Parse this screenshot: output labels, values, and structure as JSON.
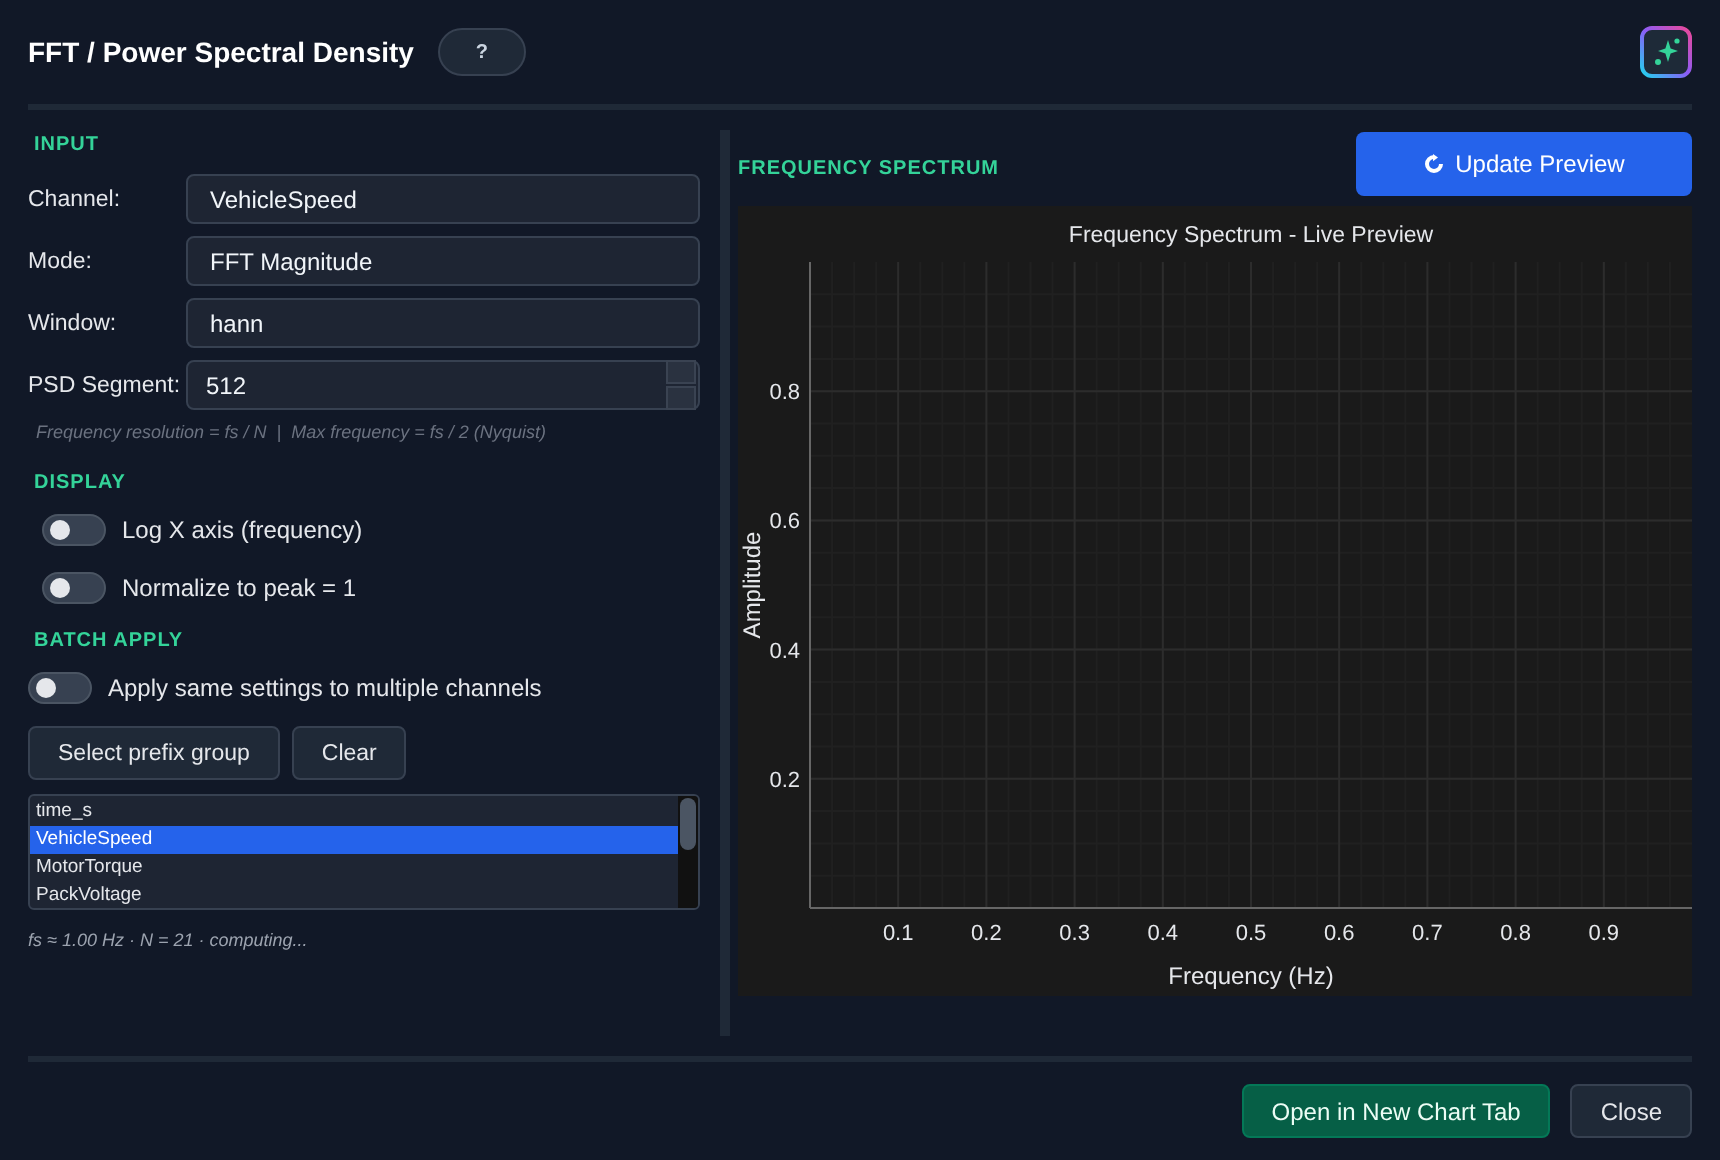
{
  "window": {
    "title": "FFT / Power Spectral Density",
    "help_button": "?"
  },
  "input": {
    "heading": "INPUT",
    "fields": [
      {
        "label": "Channel:",
        "value": "VehicleSpeed",
        "kind": "text"
      },
      {
        "label": "Mode:",
        "value": "FFT Magnitude",
        "kind": "text"
      },
      {
        "label": "Window:",
        "value": "hann",
        "kind": "text"
      },
      {
        "label": "PSD Segment:",
        "value": "512",
        "kind": "spin"
      }
    ],
    "hint": "Frequency resolution = fs / N  |  Max frequency = fs / 2 (Nyquist)"
  },
  "display": {
    "heading": "DISPLAY",
    "toggles": [
      {
        "label": "Log X axis (frequency)",
        "on": false
      },
      {
        "label": "Normalize to peak = 1",
        "on": false
      }
    ]
  },
  "batch_apply": {
    "heading": "BATCH APPLY",
    "toggle": {
      "label": "Apply same settings to multiple channels",
      "on": false
    },
    "buttons": [
      "Select prefix group",
      "Clear"
    ],
    "channels": [
      {
        "name": "time_s",
        "selected": false
      },
      {
        "name": "VehicleSpeed",
        "selected": true
      },
      {
        "name": "MotorTorque",
        "selected": false
      },
      {
        "name": "PackVoltage",
        "selected": false
      }
    ]
  },
  "status": "fs ≈ 1.00 Hz  ·  N = 21  ·  computing...",
  "spectrum": {
    "heading": "FREQUENCY SPECTRUM",
    "update_button": "Update Preview",
    "chart_data": {
      "type": "line",
      "title": "Frequency Spectrum - Live Preview",
      "xlabel": "Frequency (Hz)",
      "ylabel": "Amplitude",
      "xlim": [
        0,
        1
      ],
      "ylim": [
        0,
        1
      ],
      "xticks": [
        0.1,
        0.2,
        0.3,
        0.4,
        0.5,
        0.6,
        0.7,
        0.8,
        0.9
      ],
      "yticks": [
        0.2,
        0.4,
        0.6,
        0.8
      ],
      "grid": true
    }
  },
  "footer_buttons": [
    {
      "label": "Open in New Chart Tab",
      "kind": "primary"
    },
    {
      "label": "Close",
      "kind": "secondary"
    }
  ]
}
